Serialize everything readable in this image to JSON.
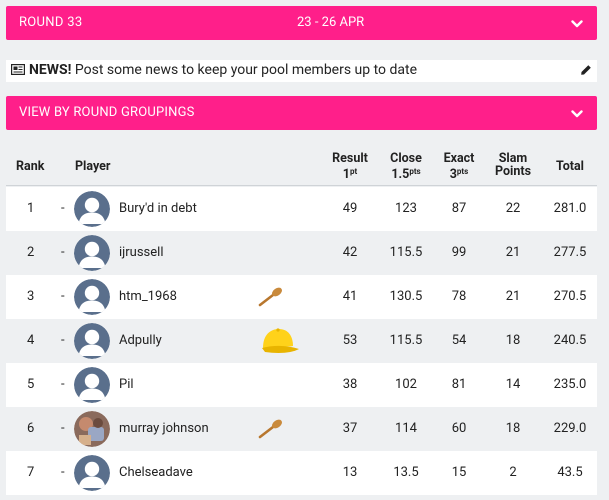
{
  "round_bar": {
    "label": "ROUND 33",
    "dates": "23 - 26 APR"
  },
  "news": {
    "bold": "NEWS!",
    "text": " Post some news to keep your pool members up to date"
  },
  "group_bar": {
    "label": "VIEW BY ROUND GROUPINGS"
  },
  "table": {
    "headers": {
      "rank": "Rank",
      "player": "Player",
      "result_line1": "Result",
      "result_line2": "1",
      "result_sup": "pt",
      "close_line1": "Close",
      "close_line2": "1.5",
      "close_sup": "pts",
      "exact_line1": "Exact",
      "exact_line2": "3",
      "exact_sup": "pts",
      "slam_line1": "Slam",
      "slam_line2": "Points",
      "total": "Total"
    },
    "rows": [
      {
        "rank": "1",
        "dash": "-",
        "player": "Bury'd in debt",
        "avatar": "default-avatar-icon",
        "badge": "",
        "result": "49",
        "close": "123",
        "exact": "87",
        "slam": "22",
        "total": "281.0"
      },
      {
        "rank": "2",
        "dash": "-",
        "player": "ijrussell",
        "avatar": "default-avatar-icon",
        "badge": "",
        "result": "42",
        "close": "115.5",
        "exact": "99",
        "slam": "21",
        "total": "277.5"
      },
      {
        "rank": "3",
        "dash": "-",
        "player": "htm_1968",
        "avatar": "default-avatar-icon",
        "badge": "wooden-spoon-icon",
        "result": "41",
        "close": "130.5",
        "exact": "78",
        "slam": "21",
        "total": "270.5"
      },
      {
        "rank": "4",
        "dash": "-",
        "player": "Adpully",
        "avatar": "default-avatar-icon",
        "badge": "yellow-cap-icon",
        "result": "53",
        "close": "115.5",
        "exact": "54",
        "slam": "18",
        "total": "240.5"
      },
      {
        "rank": "5",
        "dash": "-",
        "player": "Pil",
        "avatar": "default-avatar-icon",
        "badge": "",
        "result": "38",
        "close": "102",
        "exact": "81",
        "slam": "14",
        "total": "235.0"
      },
      {
        "rank": "6",
        "dash": "-",
        "player": "murray johnson",
        "avatar": "photo-avatar",
        "badge": "wooden-spoon-icon",
        "result": "37",
        "close": "114",
        "exact": "60",
        "slam": "18",
        "total": "229.0"
      },
      {
        "rank": "7",
        "dash": "-",
        "player": "Chelseadave",
        "avatar": "default-avatar-icon",
        "badge": "",
        "result": "13",
        "close": "13.5",
        "exact": "15",
        "slam": "2",
        "total": "43.5"
      }
    ]
  },
  "colors": {
    "accent": "#ff1f8a",
    "row_alt": "#eef0f2",
    "avatar": "#5a6f8c"
  }
}
